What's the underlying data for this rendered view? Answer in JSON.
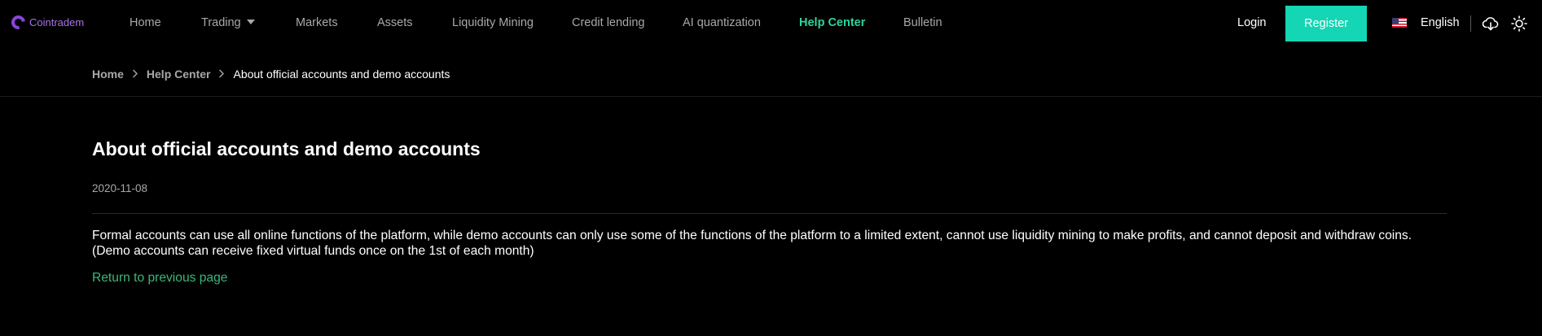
{
  "brand": {
    "name": "Cointradem",
    "color": "#8a45d8"
  },
  "nav": {
    "items": [
      {
        "label": "Home"
      },
      {
        "label": "Trading"
      },
      {
        "label": "Markets"
      },
      {
        "label": "Assets"
      },
      {
        "label": "Liquidity Mining"
      },
      {
        "label": "Credit lending"
      },
      {
        "label": "AI quantization"
      },
      {
        "label": "Help Center",
        "active": true
      },
      {
        "label": "Bulletin"
      }
    ],
    "active_color": "#2ed39a"
  },
  "auth": {
    "login_label": "Login",
    "register_label": "Register",
    "register_color": "#14d6b4"
  },
  "language": {
    "label": "English",
    "flag_icon": "us-flag-icon"
  },
  "icons": {
    "download": "cloud-download-icon",
    "theme": "sun-icon"
  },
  "breadcrumb": {
    "home": "Home",
    "section": "Help Center",
    "current": "About official accounts and demo accounts"
  },
  "article": {
    "title": "About official accounts and demo accounts",
    "date": "2020-11-08",
    "body_line1": "Formal accounts can use all online functions of the platform, while demo accounts can only use some of the functions of the platform to a limited extent, cannot use liquidity mining to make profits, and cannot deposit and withdraw coins.",
    "body_line2": "(Demo accounts can receive fixed virtual funds once on the 1st of each month)",
    "return_label": "Return to previous page",
    "link_color": "#3bb87a"
  }
}
